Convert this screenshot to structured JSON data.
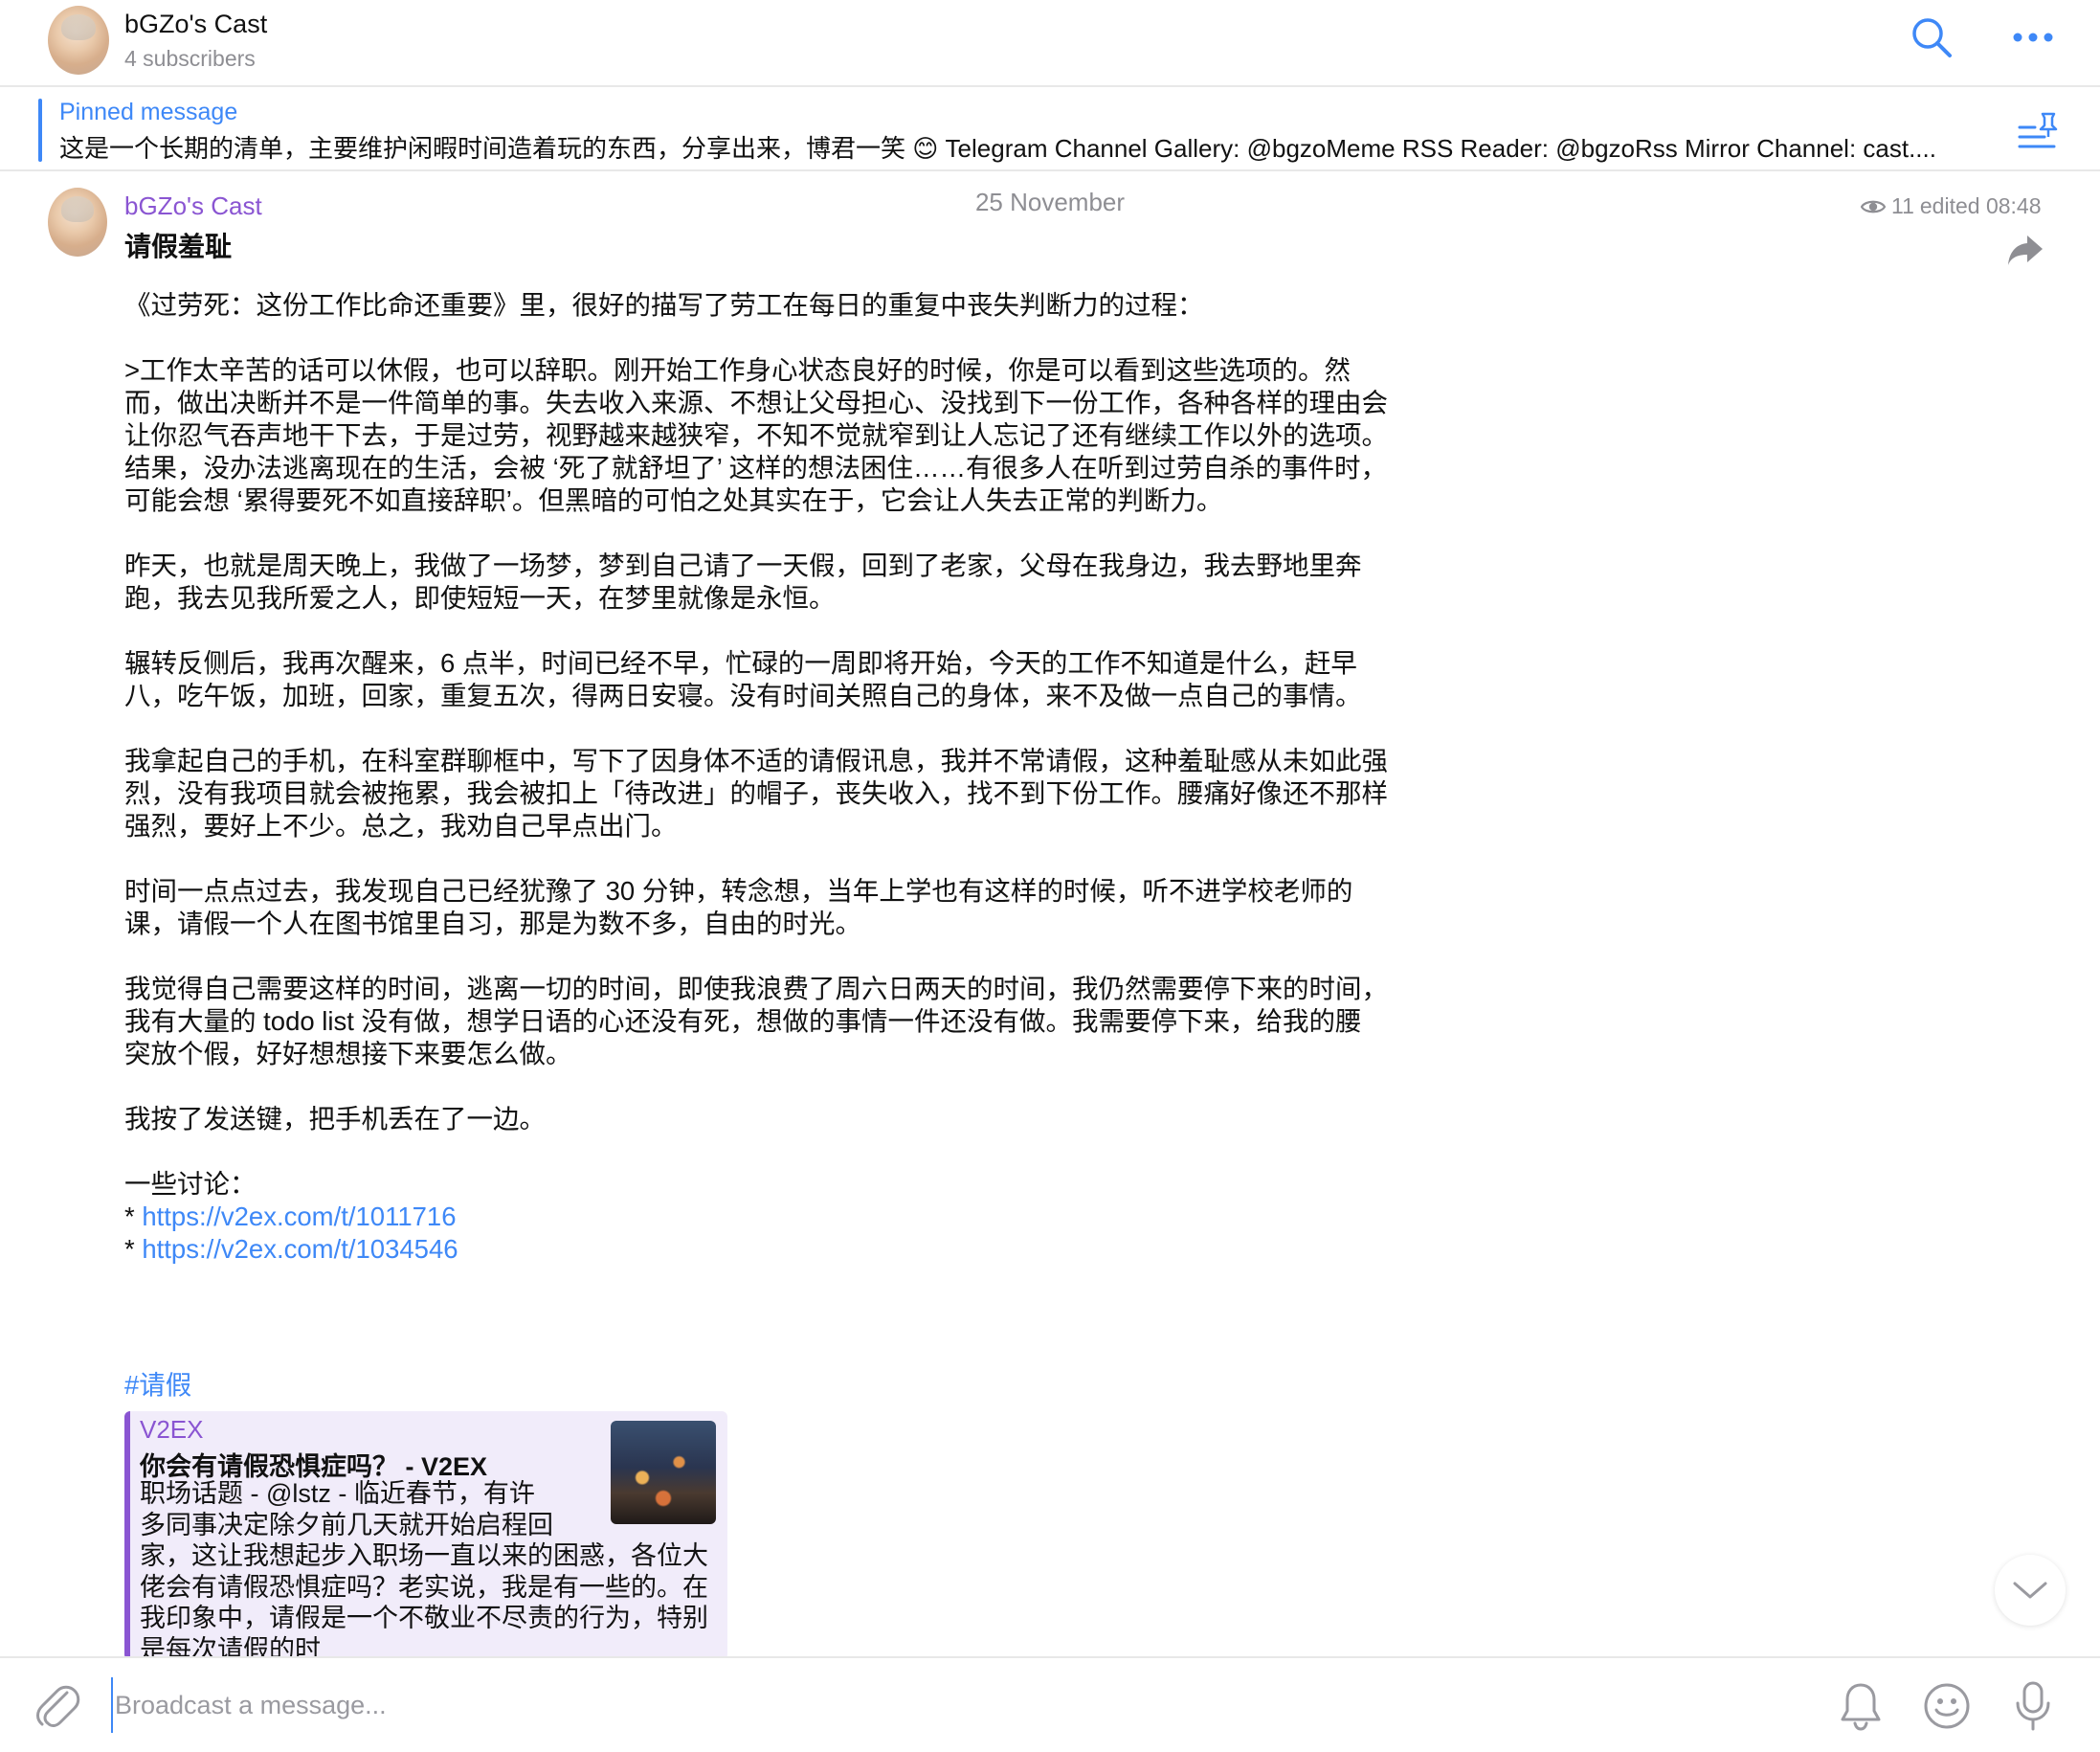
{
  "header": {
    "title": "bGZo's Cast",
    "subscribers": "4 subscribers"
  },
  "pinned": {
    "title": "Pinned message",
    "text": "这是一个长期的清单，主要维护闲暇时间造着玩的东西，分享出来，博君一笑 😊  Telegram Channel Gallery: @bgzoMeme RSS Reader: @bgzoRss  Mirror Channel: cast...."
  },
  "message": {
    "date": "25 November",
    "sender": "bGZo's Cast",
    "views": "11",
    "edited": "edited 08:48",
    "title": "请假羞耻",
    "paragraphs": [
      "《过劳死：这份工作比命还重要》里，很好的描写了劳工在每日的重复中丧失判断力的过程：",
      ">工作太辛苦的话可以休假，也可以辞职。刚开始工作身心状态良好的时候，你是可以看到这些选项的。然而，做出决断并不是一件简单的事。失去收入来源、不想让父母担心、没找到下一份工作，各种各样的理由会让你忍气吞声地干下去，于是过劳，视野越来越狭窄，不知不觉就窄到让人忘记了还有继续工作以外的选项。结果，没办法逃离现在的生活，会被 ‘死了就舒坦了’ 这样的想法困住……有很多人在听到过劳自杀的事件时，可能会想 ‘累得要死不如直接辞职’。但黑暗的可怕之处其实在于，它会让人失去正常的判断力。",
      "昨天，也就是周天晚上，我做了一场梦，梦到自己请了一天假，回到了老家，父母在我身边，我去野地里奔跑，我去见我所爱之人，即使短短一天，在梦里就像是永恒。",
      "辗转反侧后，我再次醒来，6 点半，时间已经不早，忙碌的一周即将开始，今天的工作不知道是什么，赶早八，吃午饭，加班，回家，重复五次，得两日安寝。没有时间关照自己的身体，来不及做一点自己的事情。",
      "我拿起自己的手机，在科室群聊框中，写下了因身体不适的请假讯息，我并不常请假，这种羞耻感从未如此强烈，没有我项目就会被拖累，我会被扣上「待改进」的帽子，丧失收入，找不到下份工作。腰痛好像还不那样强烈，要好上不少。总之，我劝自己早点出门。",
      "时间一点点过去，我发现自己已经犹豫了 30 分钟，转念想，当年上学也有这样的时候，听不进学校老师的课，请假一个人在图书馆里自习，那是为数不多，自由的时光。",
      "我觉得自己需要这样的时间，逃离一切的时间，即使我浪费了周六日两天的时间，我仍然需要停下来的时间，我有大量的 todo list 没有做，想学日语的心还没有死，想做的事情一件还没有做。我需要停下来，给我的腰突放个假，好好想想接下来要怎么做。",
      "我按了发送键，把手机丢在了一边。"
    ],
    "discussion_label": "一些讨论：",
    "bullet": "* ",
    "links": [
      "https://v2ex.com/t/1011716",
      "https://v2ex.com/t/1034546"
    ],
    "hashtag": "#请假"
  },
  "preview": {
    "site": "V2EX",
    "title": "你会有请假恐惧症吗？ - V2EX",
    "desc_lines": [
      "职场话题 - @lstz - 临近春节，有许",
      "多同事决定除夕前几天就开始启程回",
      "家，这让我想起步入职场一直以来的困惑，各位大佬会有请假恐惧症吗？老实说，我是有一些的。在我印象中，请假是一个不敬业不尽责的行为，特别是每次请假的时"
    ]
  },
  "composer": {
    "placeholder": "Broadcast a message..."
  },
  "colors": {
    "accent_blue": "#3e88f7",
    "sender_purple": "#8a55d2",
    "muted_gray": "#8e8e93",
    "preview_bg": "#f1ecfa"
  },
  "icons": [
    "search-icon",
    "more-icon",
    "pinned-list-icon",
    "eye-icon",
    "share-icon",
    "scroll-down-icon",
    "attach-icon",
    "bell-icon",
    "emoji-icon",
    "mic-icon"
  ]
}
